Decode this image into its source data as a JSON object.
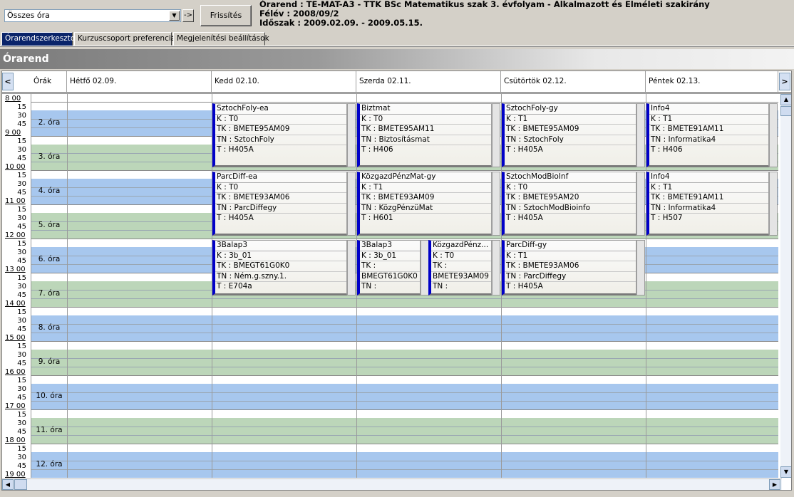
{
  "toolbar": {
    "filter_value": "Összes óra",
    "go_label": "->",
    "refresh_label": "Frissítés"
  },
  "header": {
    "title": "Órarend : TE-MAT-A3 - TTK BSc Matematikus szak 3. évfolyam - Alkalmazott és Elméleti szakirány",
    "semester": "Félév : 2008/09/2",
    "period": "Időszak : 2009.02.09. - 2009.05.15."
  },
  "tabs": [
    {
      "label": "Órarendszerkeszto",
      "active": true
    },
    {
      "label": "Kurzuscsoport preferenciák",
      "active": false
    },
    {
      "label": "Megjelenítési beállítások",
      "active": false
    }
  ],
  "panel": {
    "title": "Órarend"
  },
  "columns": {
    "hours_header": "Órák",
    "days": [
      "Hétfő  02.09.",
      "Kedd  02.10.",
      "Szerda  02.11.",
      "Csütörtök  02.12.",
      "Péntek  02.13."
    ]
  },
  "time_labels": {
    "hours": [
      "8 00",
      "9 00",
      "10 00",
      "11 00",
      "12 00",
      "13 00",
      "14 00",
      "15 00",
      "16 00",
      "17 00",
      "18 00",
      "19 00"
    ],
    "quarters": [
      "15",
      "30",
      "45"
    ]
  },
  "periods": [
    "2. óra",
    "3. óra",
    "4. óra",
    "5. óra",
    "6. óra",
    "7. óra",
    "8. óra",
    "9. óra",
    "10. óra",
    "11. óra",
    "12. óra"
  ],
  "courses": [
    {
      "day": 1,
      "title": "SztochFoly-ea",
      "k": "K : T0",
      "tk": "TK : BMETE95AM09",
      "tn": "TN : SztochFoly",
      "t": "T : H405A"
    },
    {
      "day": 2,
      "title": "Biztmat",
      "k": "K : T0",
      "tk": "TK : BMETE95AM11",
      "tn": "TN : Biztosításmat",
      "t": "T : H406"
    },
    {
      "day": 3,
      "title": "SztochFoly-gy",
      "k": "K : T1",
      "tk": "TK : BMETE95AM09",
      "tn": "TN : SztochFoly",
      "t": "T : H405A"
    },
    {
      "day": 4,
      "title": "Info4",
      "k": "K : T1",
      "tk": "TK : BMETE91AM11",
      "tn": "TN : Informatika4",
      "t": "T : H406"
    },
    {
      "day": 1,
      "title": "ParcDiff-ea",
      "k": "K : T0",
      "tk": "TK : BMETE93AM06",
      "tn": "TN : ParcDiffegy",
      "t": "T : H405A"
    },
    {
      "day": 2,
      "title": "KözgazdPénzMat-gy",
      "k": "K : T1",
      "tk": "TK : BMETE93AM09",
      "tn": "TN : KözgPénzüMat",
      "t": "T : H601"
    },
    {
      "day": 3,
      "title": "SztochModBioInf",
      "k": "K : T0",
      "tk": "TK : BMETE95AM20",
      "tn": "TN : SztochModBioinfo",
      "t": "T : H405A"
    },
    {
      "day": 4,
      "title": "Info4",
      "k": "K : T1",
      "tk": "TK : BMETE91AM11",
      "tn": "TN : Informatika4",
      "t": "T : H507"
    },
    {
      "day": 1,
      "title": "3Balap3",
      "k": "K : 3b_01",
      "tk": "TK : BMEGT61G0K0",
      "tn": "TN : Ném.g.szny.1.",
      "t": "T : E704a"
    },
    {
      "day": 2,
      "title": "3Balap3",
      "k": "K : 3b_01",
      "tk": "TK :",
      "tn": "BMEGT61G0K0",
      "t": "TN :"
    },
    {
      "day": 2,
      "title": "KözgazdPénz...",
      "k": "K : T0",
      "tk": "TK :",
      "tn": "BMETE93AM09",
      "t": "TN :"
    },
    {
      "day": 3,
      "title": "ParcDiff-gy",
      "k": "K : T1",
      "tk": "TK : BMETE93AM06",
      "tn": "TN : ParcDiffegy",
      "t": "T : H405A"
    }
  ],
  "colors": {
    "blue_band": "#a7c7ee",
    "green_band": "#bcd6b9",
    "course_accent": "#0000c8",
    "tab_active": "#0a246a"
  },
  "icons": {
    "nav_prev": "chevron-left-icon",
    "nav_next": "chevron-right-icon",
    "dropdown": "chevron-down-icon"
  }
}
